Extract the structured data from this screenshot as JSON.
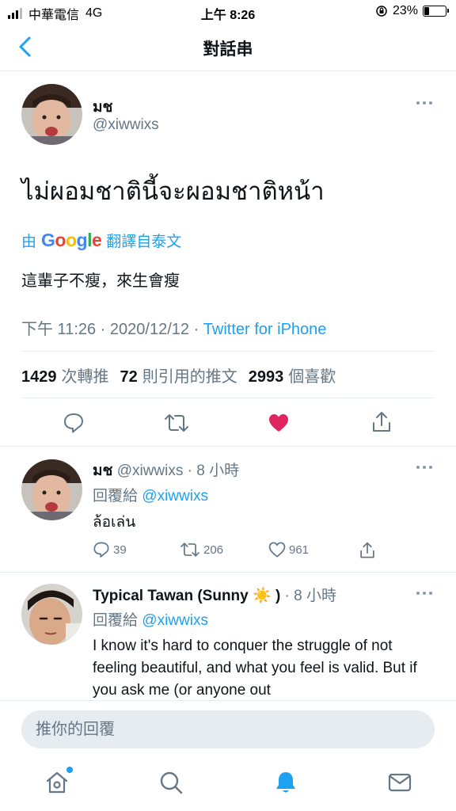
{
  "status_bar": {
    "carrier": "中華電信",
    "network": "4G",
    "time": "上午 8:26",
    "battery_percent": "23%",
    "battery_level": 0.23
  },
  "header": {
    "title": "對話串"
  },
  "main_tweet": {
    "name": "มช",
    "handle": "@xiwwixs",
    "text": "ไม่ผอมชาตินี้จะผอมชาติหน้า",
    "translate_prefix": "由",
    "translate_provider": "Google",
    "translate_suffix": "翻譯自泰文",
    "translated_text": "這輩子不瘦，來生會瘦",
    "time": "下午 11:26",
    "date": "2020/12/12",
    "source": "Twitter for iPhone",
    "retweets_count": "1429",
    "retweets_label": "次轉推",
    "quotes_count": "72",
    "quotes_label": "則引用的推文",
    "likes_count": "2993",
    "likes_label": "個喜歡",
    "liked": true,
    "like_color": "#e0245e"
  },
  "replies": [
    {
      "name": "มช",
      "handle": "@xiwwixs",
      "time": "8 小時",
      "reply_to_label": "回覆給",
      "reply_to": "@xiwwixs",
      "text": "ล้อเล่น",
      "replies": "39",
      "retweets": "206",
      "likes": "961"
    },
    {
      "name": "Typical Tawan (Sunny",
      "name_emoji": "☀️",
      "name_close": ")",
      "time": "8 小時",
      "reply_to_label": "回覆給",
      "reply_to": "@xiwwixs",
      "text": "I know it's hard to conquer the struggle of not feeling beautiful, and what you feel is valid. But if you ask me (or anyone out"
    }
  ],
  "reply_bar": {
    "placeholder": "推你的回覆"
  },
  "tab_bar": {
    "items": [
      "home-icon",
      "search-icon",
      "notifications-icon",
      "messages-icon"
    ],
    "active": "notifications-icon",
    "accent": "#1da1f2"
  }
}
